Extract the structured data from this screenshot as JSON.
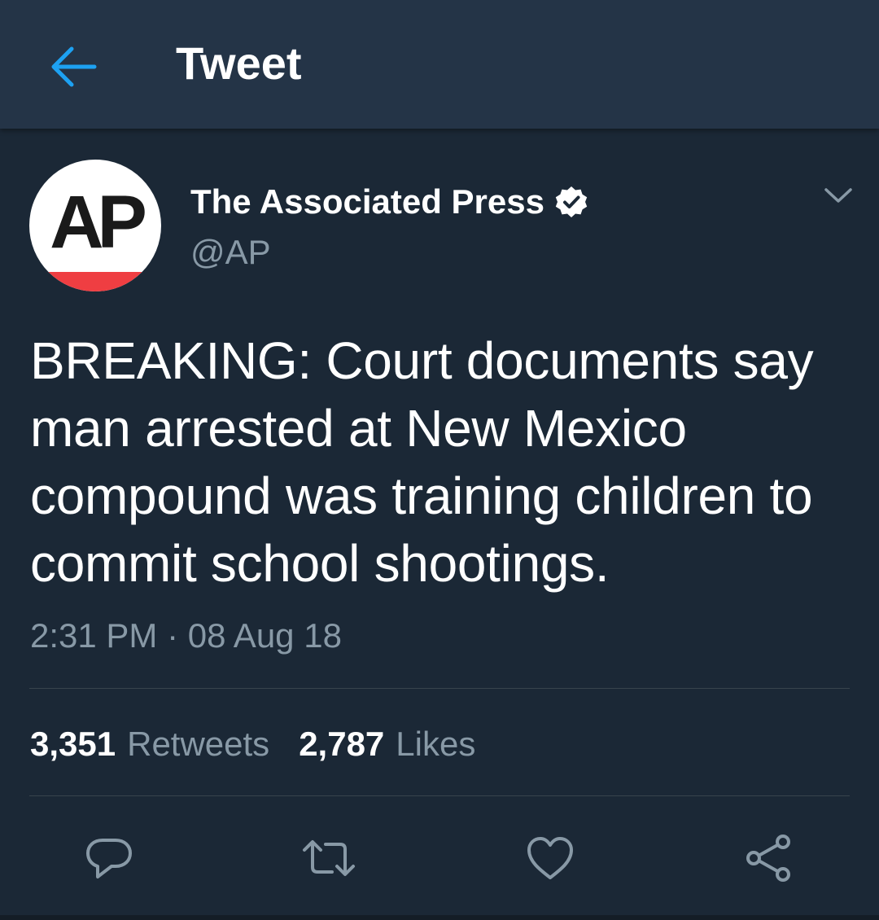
{
  "header": {
    "title": "Tweet",
    "back_icon": "arrow-left-icon"
  },
  "author": {
    "avatar_text": "AP",
    "display_name": "The Associated Press",
    "verified": true,
    "handle": "@AP"
  },
  "tweet": {
    "text": "BREAKING: Court documents say man arrested at New Mexico compound was training children to commit school shootings.",
    "timestamp": "2:31 PM · 08 Aug 18"
  },
  "stats": {
    "retweets_count": "3,351",
    "retweets_label": "Retweets",
    "likes_count": "2,787",
    "likes_label": "Likes"
  },
  "actions": [
    "reply-icon",
    "retweet-icon",
    "like-icon",
    "share-icon"
  ],
  "colors": {
    "header_bg": "#243447",
    "page_bg": "#1b2836",
    "accent": "#1da1f2",
    "secondary_text": "#8899a6",
    "ap_red": "#ef3e42"
  }
}
